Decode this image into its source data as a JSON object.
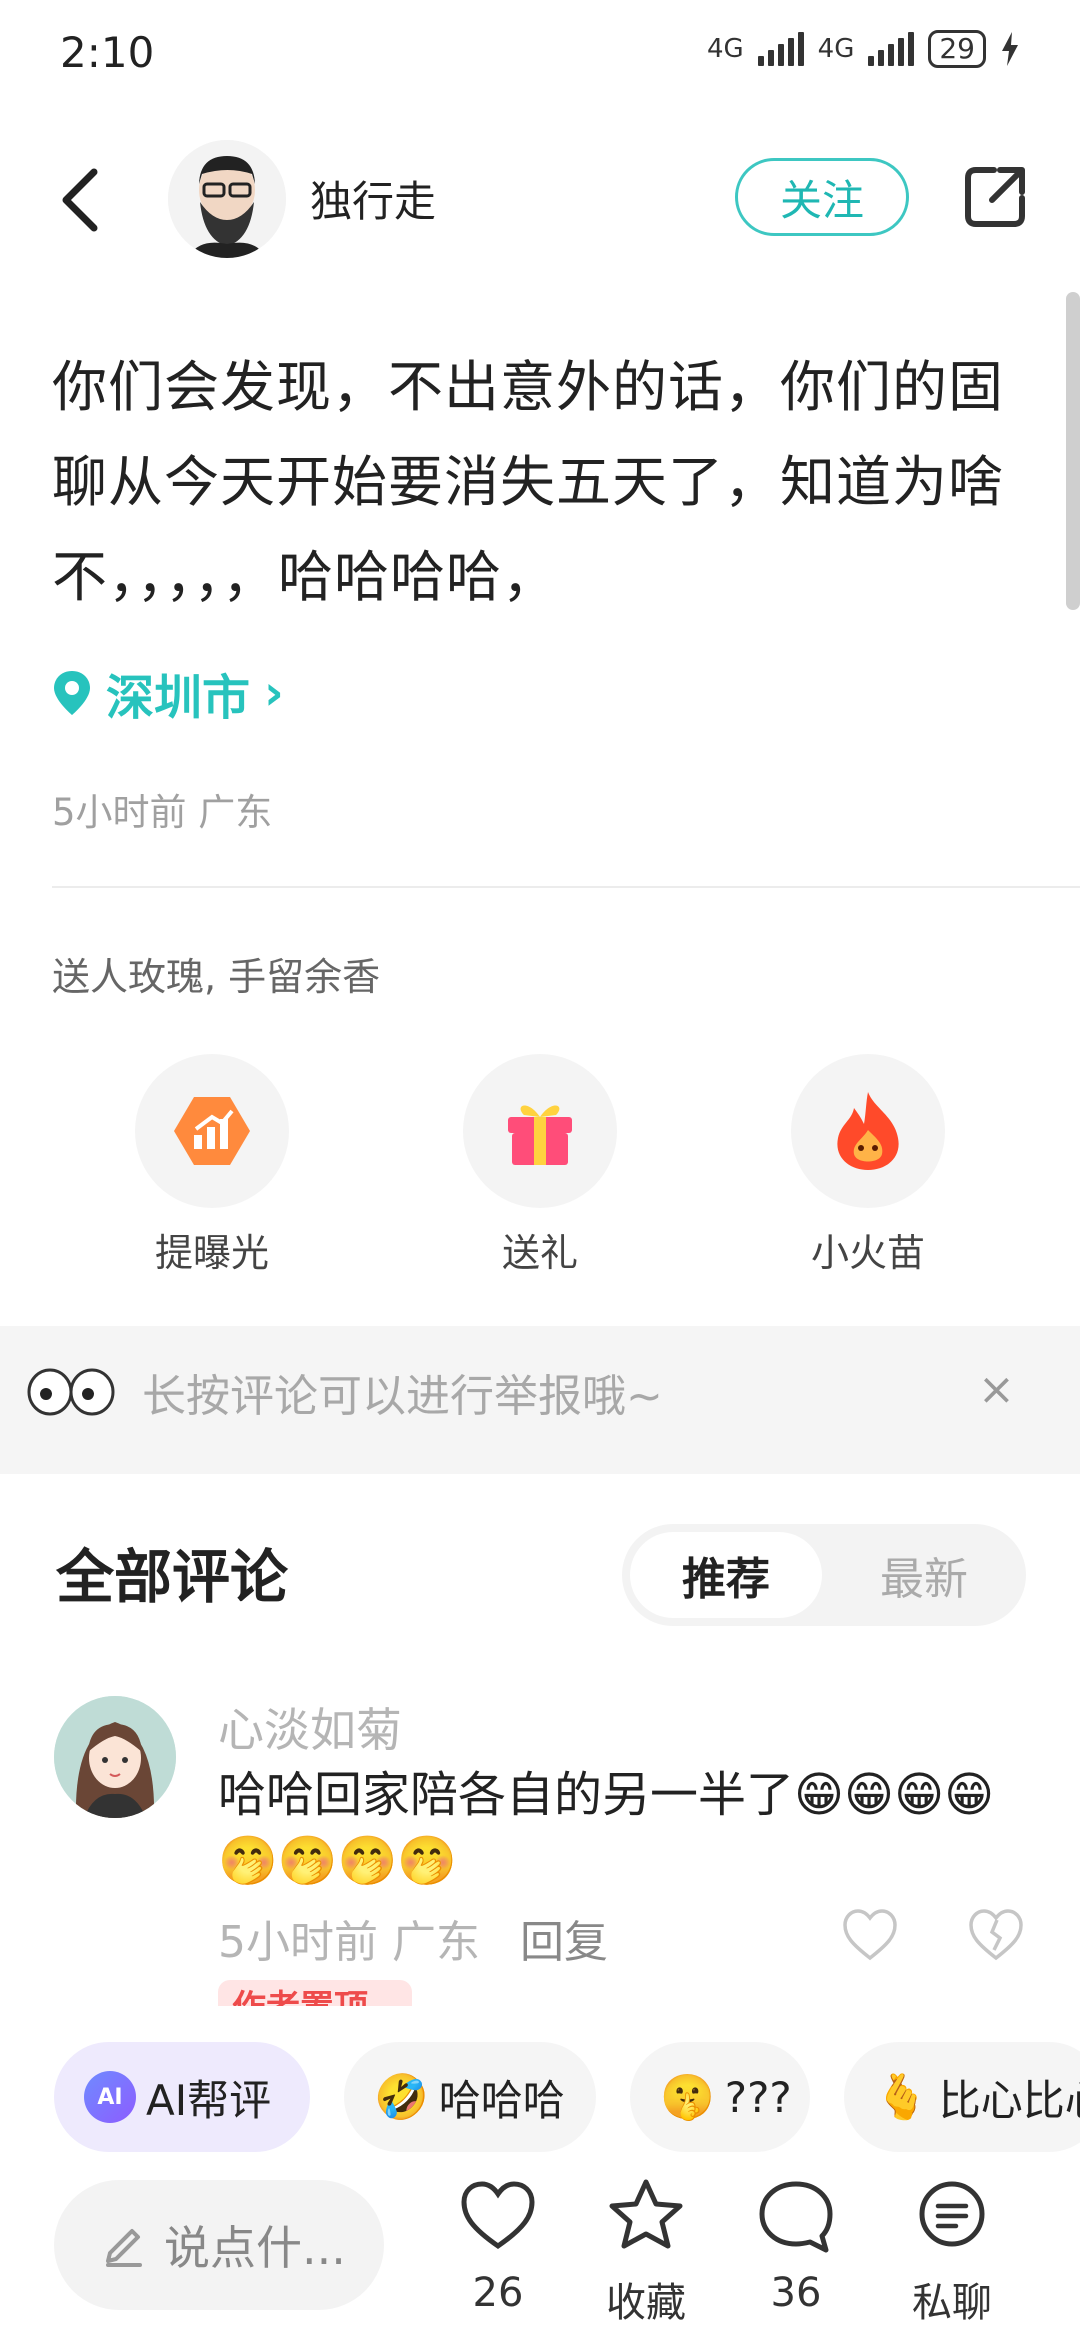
{
  "status_bar": {
    "time": "2:10",
    "network1": "4G",
    "network2": "4G",
    "battery": "29"
  },
  "header": {
    "author_name": "独行走",
    "follow_label": "关注"
  },
  "post": {
    "text": "你们会发现，不出意外的话，你们的固聊从今天开始要消失五天了，知道为啥不，，，，，哈哈哈哈，",
    "location": "深圳市",
    "location_arrow": "›",
    "meta": "5小时前  广东"
  },
  "gifts": {
    "prompt": "送人玫瑰, 手留余香",
    "actions": [
      {
        "label": "提曝光",
        "icon": "boost-exposure-icon"
      },
      {
        "label": "送礼",
        "icon": "gift-icon"
      },
      {
        "label": "小火苗",
        "icon": "flame-icon"
      }
    ]
  },
  "report_banner": {
    "text": "长按评论可以进行举报哦~",
    "close": "×"
  },
  "comments": {
    "title": "全部评论",
    "sort": {
      "active": "推荐",
      "inactive": "最新"
    },
    "items": [
      {
        "user": "心淡如菊",
        "text": "哈哈回家陪各自的另一半了😁😁😁😁🤭🤭🤭🤭",
        "meta": "5小时前  广东",
        "reply": "回复",
        "badge": "作者置顶"
      }
    ]
  },
  "quick_replies": {
    "ai": {
      "badge": "AI",
      "label": "AI帮评"
    },
    "items": [
      {
        "emoji": "🤣",
        "text": "哈哈哈"
      },
      {
        "emoji": "🤫",
        "text": "???"
      },
      {
        "emoji": "🫰",
        "text": "比心比心"
      }
    ]
  },
  "bottom_bar": {
    "input_placeholder": "说点什...",
    "like_count": "26",
    "favorite_label": "收藏",
    "comment_count": "36",
    "message_label": "私聊"
  },
  "colors": {
    "accent": "#27c3bd",
    "badge_red": "#ee4b4b"
  }
}
